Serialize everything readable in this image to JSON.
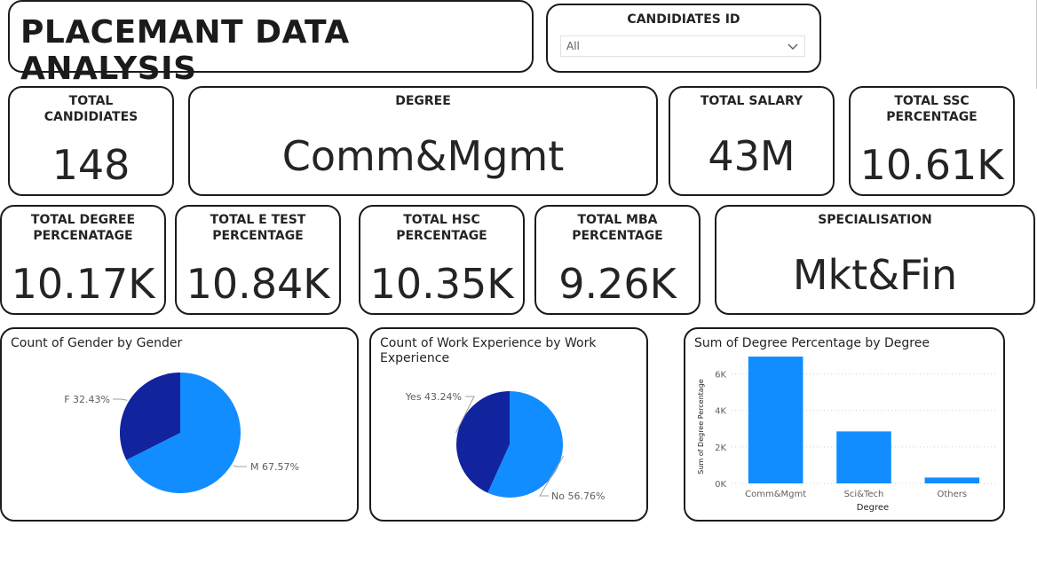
{
  "header": {
    "title": "PLACEMANT DATA ANALYSIS"
  },
  "slicer": {
    "label": "CANDIDIATES ID",
    "value": "All"
  },
  "kpis": {
    "total_candidates": {
      "label": "TOTAL\nCANDIDIATES",
      "value": "148"
    },
    "degree": {
      "label": "DEGREE",
      "value": "Comm&Mgmt"
    },
    "total_salary": {
      "label": "TOTAL SALARY",
      "value": "43M"
    },
    "total_ssc": {
      "label": "TOTAL SSC\nPERCENTAGE",
      "value": "10.61K"
    },
    "total_degree": {
      "label": "TOTAL DEGREE\nPERCENATAGE",
      "value": "10.17K"
    },
    "total_etest": {
      "label": "TOTAL E TEST\nPERCENTAGE",
      "value": "10.84K"
    },
    "total_hsc": {
      "label": "TOTAL HSC\nPERCENTAGE",
      "value": "10.35K"
    },
    "total_mba": {
      "label": "TOTAL MBA\nPERCENTAGE",
      "value": "9.26K"
    },
    "specialisation": {
      "label": "SPECIALISATION",
      "value": "Mkt&Fin"
    }
  },
  "colors": {
    "primary": "#118DFF",
    "secondary": "#12239E",
    "border": "#1b1b1b",
    "text": "#252423"
  },
  "chart_data": [
    {
      "type": "pie",
      "title": "Count of Gender by Gender",
      "slices": [
        {
          "label": "M 67.57%",
          "category": "M",
          "value": 67.57
        },
        {
          "label": "F 32.43%",
          "category": "F",
          "value": 32.43
        }
      ]
    },
    {
      "type": "pie",
      "title": "Count of Work Experience by Work Experience",
      "slices": [
        {
          "label": "No 56.76%",
          "category": "No",
          "value": 56.76
        },
        {
          "label": "Yes 43.24%",
          "category": "Yes",
          "value": 43.24
        }
      ]
    },
    {
      "type": "bar",
      "title": "Sum of Degree Percentage by Degree",
      "categories": [
        "Comm&Mgmt",
        "Sci&Tech",
        "Others"
      ],
      "values": [
        6950,
        2850,
        320
      ],
      "xlabel": "Degree",
      "ylabel": "Sum of Degree Percentage",
      "ylim": [
        0,
        7000
      ],
      "yticks": [
        0,
        2000,
        4000,
        6000
      ],
      "ytick_labels": [
        "0K",
        "2K",
        "4K",
        "6K"
      ],
      "grid": true
    }
  ]
}
